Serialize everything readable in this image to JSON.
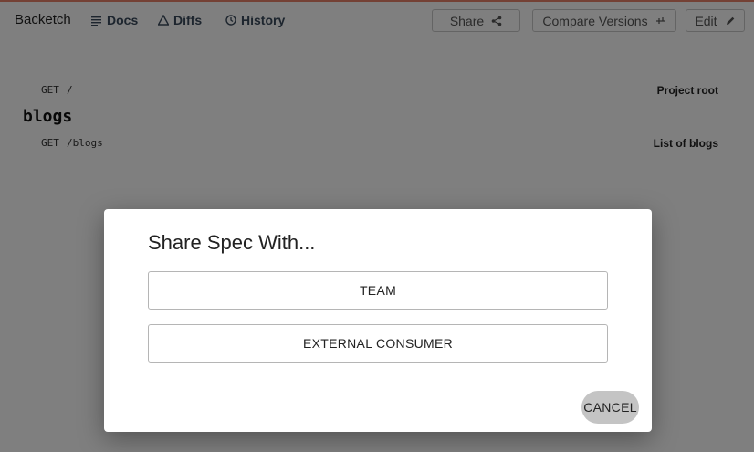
{
  "header": {
    "brand": "Backetch",
    "nav": [
      {
        "label": "Docs",
        "icon": "list-icon"
      },
      {
        "label": "Diffs",
        "icon": "triangle-icon"
      },
      {
        "label": "History",
        "icon": "clock-icon"
      }
    ],
    "buttons": {
      "share": "Share",
      "compare": "Compare Versions",
      "edit": "Edit"
    },
    "accent_color": "#e8836a"
  },
  "endpoints": {
    "root": {
      "method": "GET",
      "path": "/",
      "description": "Project root"
    },
    "group_title": "blogs",
    "blogs": {
      "method": "GET",
      "path": "/blogs",
      "description": "List of blogs"
    }
  },
  "dialog": {
    "title": "Share Spec With...",
    "options": [
      "TEAM",
      "EXTERNAL CONSUMER"
    ],
    "cancel": "CANCEL"
  }
}
